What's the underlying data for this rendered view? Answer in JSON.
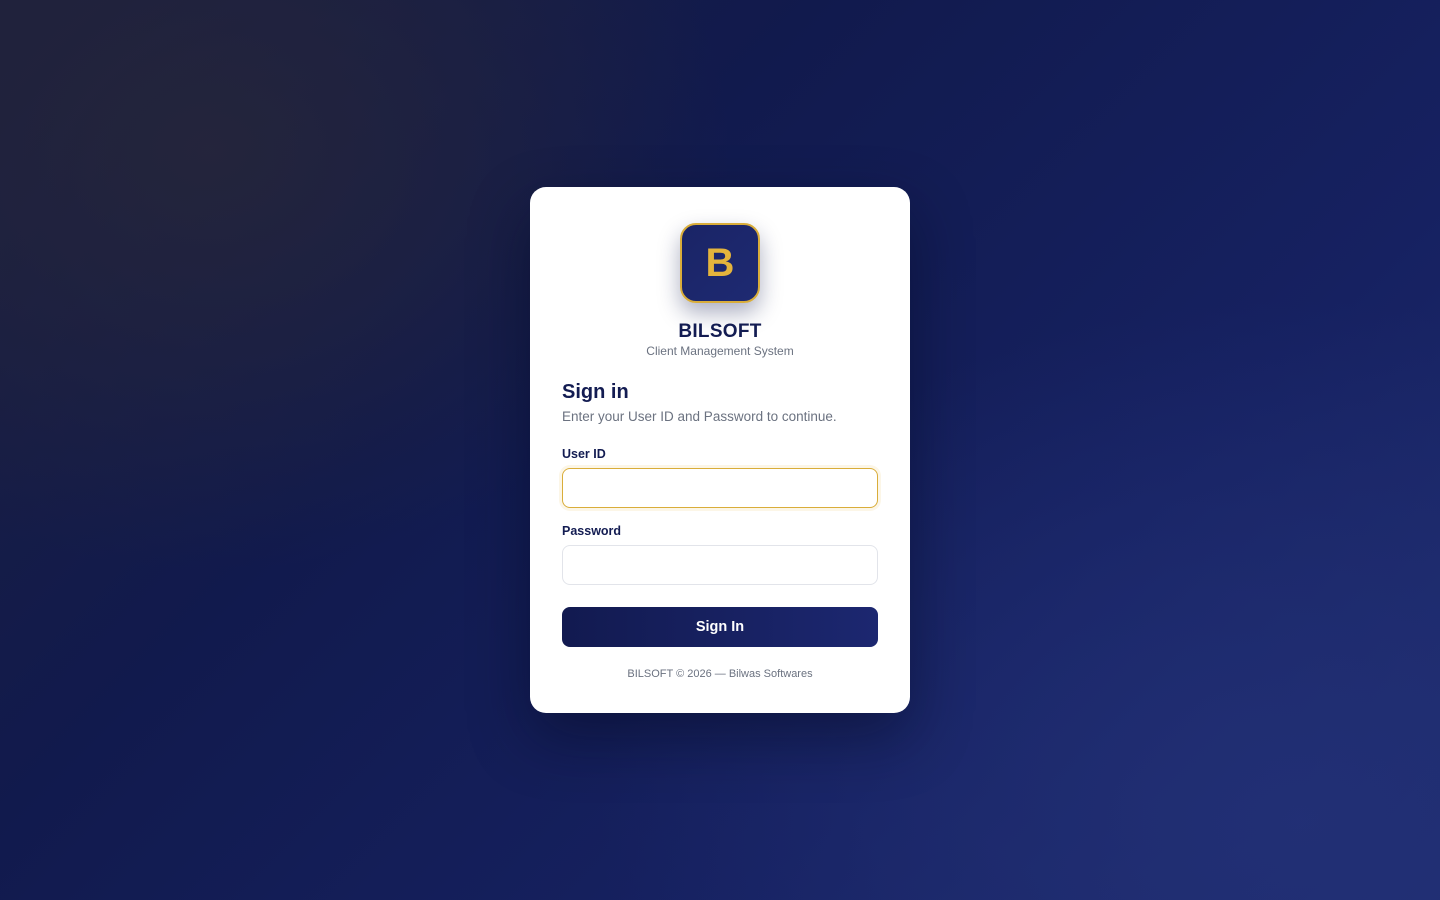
{
  "brand": {
    "logo_letter": "B",
    "name": "BILSOFT",
    "tagline": "Client Management System"
  },
  "signin": {
    "heading": "Sign in",
    "subheading": "Enter your User ID and Password to continue."
  },
  "form": {
    "user_id_label": "User ID",
    "user_id_value": "",
    "password_label": "Password",
    "password_value": "",
    "submit_label": "Sign In"
  },
  "footer": {
    "text": "BILSOFT © 2026 — Bilwas Softwares"
  },
  "colors": {
    "primary_navy": "#131c52",
    "accent_gold": "#e4b43c",
    "muted_text": "#6b7280",
    "card_background": "#ffffff"
  }
}
